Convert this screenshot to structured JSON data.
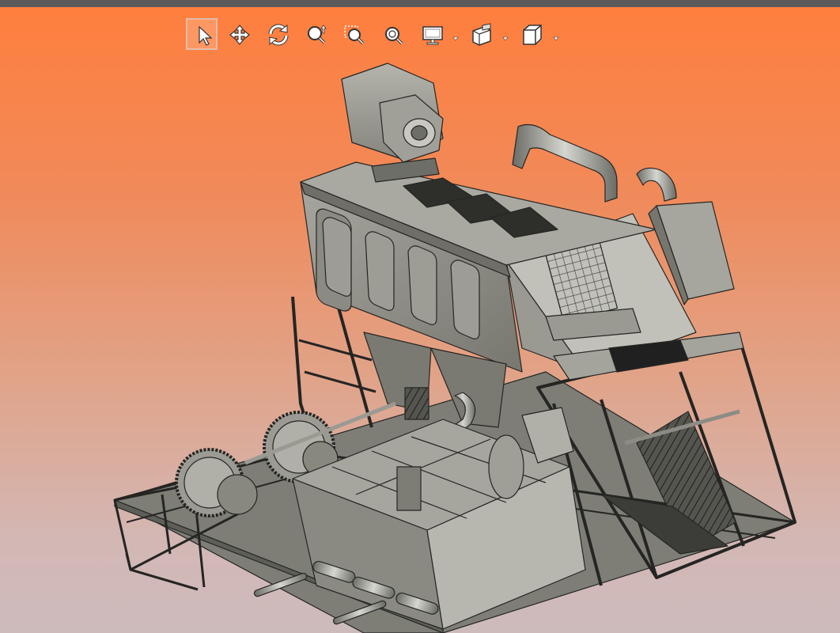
{
  "toolbar": {
    "tools": [
      {
        "name": "select",
        "icon": "cursor-arrow-icon",
        "active": true
      },
      {
        "name": "pan",
        "icon": "pan-arrows-icon",
        "active": false
      },
      {
        "name": "rotate",
        "icon": "rotate-icon",
        "active": false
      },
      {
        "name": "zoom",
        "icon": "zoom-updown-icon",
        "active": false
      },
      {
        "name": "zoom-window",
        "icon": "zoom-window-icon",
        "active": false
      },
      {
        "name": "zoom-fit",
        "icon": "zoom-fit-icon",
        "active": false
      },
      {
        "name": "display-mode",
        "icon": "monitor-icon",
        "active": false,
        "dropdown": true
      },
      {
        "name": "section",
        "icon": "section-plane-icon",
        "active": false,
        "dropdown": true
      },
      {
        "name": "view-orientation",
        "icon": "cube-view-icon",
        "active": false,
        "dropdown": true
      }
    ]
  },
  "colors": {
    "titlebar": "#5a5a5a",
    "background_top": "#ff7f3e",
    "background_bottom": "#cdbbbc",
    "model_body": "#8e8e86",
    "model_dark": "#3a3a36",
    "model_edge": "#2a2a28"
  }
}
